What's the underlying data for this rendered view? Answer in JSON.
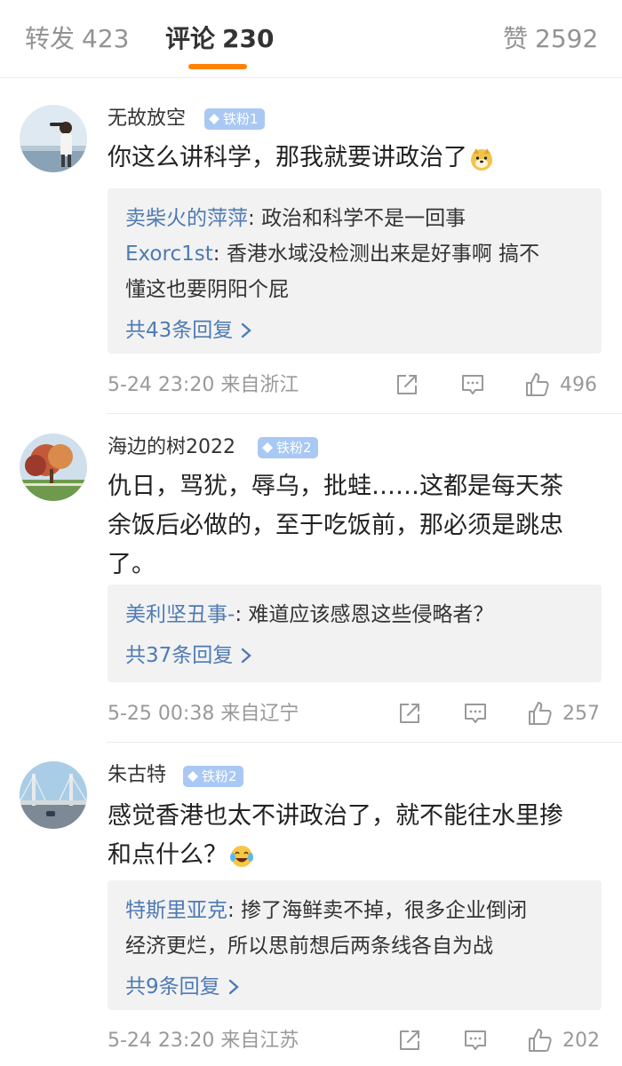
{
  "tabs": [
    {
      "label": "转发",
      "count": "423"
    },
    {
      "label": "评论",
      "count": "230"
    },
    {
      "label": "赞",
      "count": "2592"
    }
  ],
  "comments": [
    {
      "name": "无故放空",
      "badge": "铁粉1",
      "text_lines": [
        "你这么讲科学，那我就要讲政治了"
      ],
      "text_emoji": "doge-emoji",
      "replies": [
        {
          "name": "卖柴火的萍萍",
          "text_lines": [
            "政治和科学不是一回事"
          ]
        },
        {
          "name": "Exorc1st",
          "text_lines": [
            "香港水域没检测出来是好事啊 搞不",
            "懂这也要阴阳个屁"
          ]
        }
      ],
      "more": "共43条回复",
      "time": "5-24 23:20",
      "location": "来自浙江",
      "likes": "496"
    },
    {
      "name": "海边的树2022",
      "badge": "铁粉2",
      "text_lines": [
        "仇日，骂犹，辱乌，批蛙……这都是每天茶",
        "余饭后必做的，至于吃饭前，那必须是跳忠",
        "了。"
      ],
      "replies": [
        {
          "name": "美利坚丑事-",
          "text_lines": [
            "难道应该感恩这些侵略者？"
          ]
        }
      ],
      "more": "共37条回复",
      "time": "5-25 00:38",
      "location": "来自辽宁",
      "likes": "257"
    },
    {
      "name": "朱古特",
      "badge": "铁粉2",
      "text_lines": [
        "感觉香港也太不讲政治了，就不能往水里掺",
        "和点什么？"
      ],
      "text_emoji": "laugh-cry-emoji",
      "replies": [
        {
          "name": "特斯里亚克",
          "text_lines": [
            "掺了海鲜卖不掉，很多企业倒闭",
            "经济更烂，所以思前想后两条线各自为战"
          ]
        }
      ],
      "more": "共9条回复",
      "time": "5-24 23:20",
      "location": "来自江苏",
      "likes": "202"
    }
  ],
  "colors": {
    "accent": "#ff8200",
    "link": "#4e7ab4",
    "badge": "#a9c8f3",
    "muted": "#999999"
  }
}
